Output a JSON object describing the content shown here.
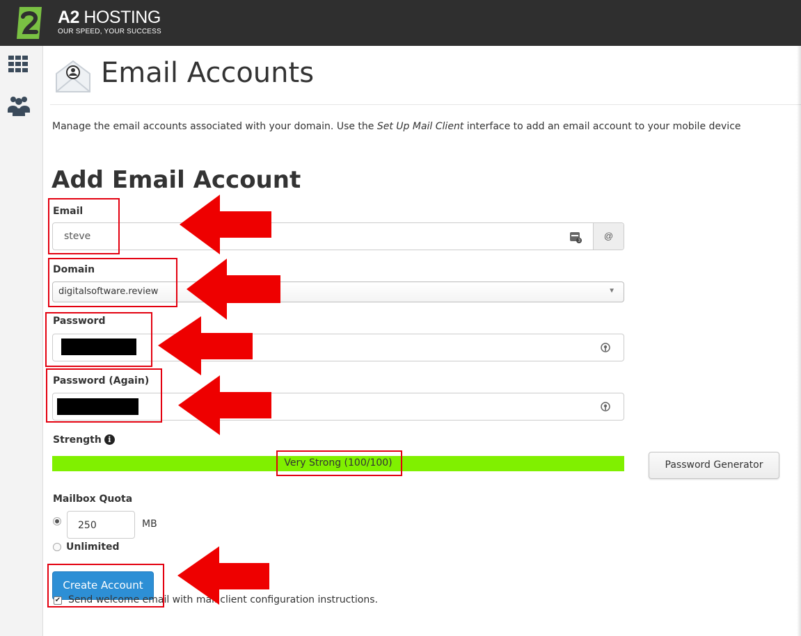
{
  "brand": {
    "name_bold": "A2",
    "name_rest": " HOSTING",
    "tagline": "OUR SPEED, YOUR SUCCESS"
  },
  "page": {
    "title": "Email Accounts",
    "description_pre": "Manage the email accounts associated with your domain. Use the ",
    "description_link": "Set Up Mail Client",
    "description_post": " interface to add an email account to your mobile device"
  },
  "form": {
    "section_title": "Add Email Account",
    "email_label": "Email",
    "email_value": "steve",
    "email_addon": "@",
    "domain_label": "Domain",
    "domain_value": "digitalsoftware.review",
    "password_label": "Password",
    "password_again_label": "Password (Again)",
    "strength_label": "Strength",
    "strength_text": "Very Strong (100/100)",
    "strength_score": 100,
    "strength_color": "#80f000",
    "generator_button": "Password Generator",
    "quota_label": "Mailbox Quota",
    "quota_value": "250",
    "quota_unit": "MB",
    "quota_unlimited": "Unlimited",
    "create_button": "Create Account",
    "welcome_email": "Send welcome email with mail client configuration instructions."
  },
  "icons": {
    "apps": "grid-icon",
    "users": "users-icon",
    "envelope": "envelope-icon",
    "info": "info-icon",
    "keypad": "keypad-icon",
    "eye": "password-toggle-icon"
  },
  "colors": {
    "accent": "#2d8fd5",
    "annotation": "#e3000f"
  }
}
